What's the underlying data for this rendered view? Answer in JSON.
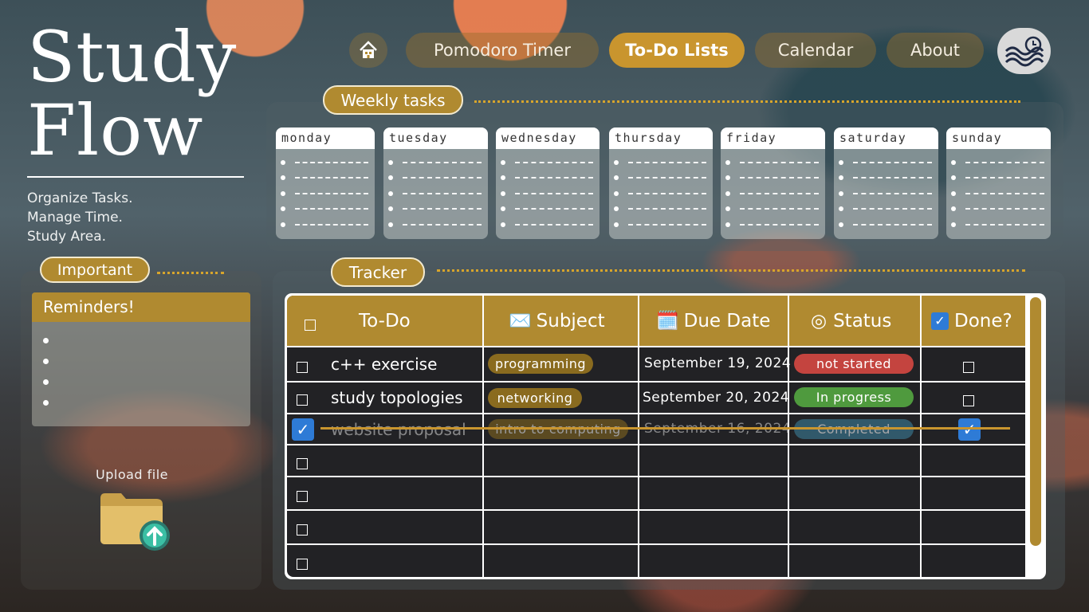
{
  "brand": {
    "line1": "Study",
    "line2": "Flow",
    "tagline": [
      "Organize Tasks.",
      "Manage Time.",
      "Study Area."
    ]
  },
  "nav": {
    "home_icon": "home-icon",
    "items": [
      {
        "label": "Pomodoro Timer",
        "active": false
      },
      {
        "label": "To-Do Lists",
        "active": true
      },
      {
        "label": "Calendar",
        "active": false
      },
      {
        "label": "About",
        "active": false
      }
    ],
    "logo_icon": "wave-clock-logo"
  },
  "weekly": {
    "title": "Weekly tasks",
    "days": [
      "monday",
      "tuesday",
      "wednesday",
      "thursday",
      "friday",
      "saturday",
      "sunday"
    ]
  },
  "important": {
    "title": "Important",
    "reminders_title": "Reminders!"
  },
  "upload": {
    "label": "Upload file",
    "icon": "folder-upload-icon"
  },
  "tracker": {
    "title": "Tracker",
    "headers": {
      "todo": "To-Do",
      "subject": "Subject",
      "subject_icon": "✉️",
      "due": "Due Date",
      "due_icon": "🗓️",
      "status": "Status",
      "status_icon": "◎",
      "done": "Done?",
      "done_icon": "☑"
    },
    "rows": [
      {
        "todo": "c++ exercise",
        "subject": "programming",
        "due": "September 19, 2024",
        "status": "not started",
        "checked": false
      },
      {
        "todo": "study topologies",
        "subject": "networking",
        "due": "September 20, 2024",
        "status": "In progress",
        "checked": false
      },
      {
        "todo": "website proposal",
        "subject": "intro to computing",
        "due": "September 16, 2024",
        "status": "Completed",
        "checked": true
      }
    ]
  },
  "colors": {
    "accent": "#b08a30",
    "accent_active": "#c9952e",
    "status_not_started": "#c4443f",
    "status_in_progress": "#4f9a3e",
    "status_completed": "#3c7f9a",
    "checkbox_blue": "#2e7bd6"
  }
}
